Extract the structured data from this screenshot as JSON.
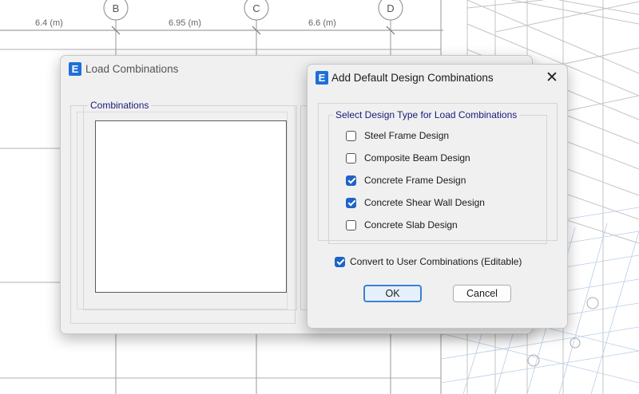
{
  "drawing": {
    "dimensions": [
      "6.4 (m)",
      "6.95 (m)",
      "6.6 (m)"
    ],
    "grid_bubbles": [
      "B",
      "C",
      "D"
    ]
  },
  "load_combinations_window": {
    "icon": "E",
    "title": "Load Combinations",
    "combinations_group_label": "Combinations"
  },
  "dialog": {
    "icon": "E",
    "title": "Add Default Design Combinations",
    "close_glyph": "✕",
    "group_label": "Select Design Type for Load Combinations",
    "design_types": [
      {
        "label": "Steel Frame Design",
        "checked": false
      },
      {
        "label": "Composite Beam Design",
        "checked": false
      },
      {
        "label": "Concrete Frame Design",
        "checked": true
      },
      {
        "label": "Concrete Shear Wall Design",
        "checked": true
      },
      {
        "label": "Concrete Slab Design",
        "checked": false
      }
    ],
    "convert": {
      "label": "Convert to User Combinations (Editable)",
      "checked": true
    },
    "ok_label": "OK",
    "cancel_label": "Cancel"
  },
  "colors": {
    "accent": "#1e63c8",
    "app_icon": "#1e6fd9",
    "group_text": "#1a1a7a"
  }
}
